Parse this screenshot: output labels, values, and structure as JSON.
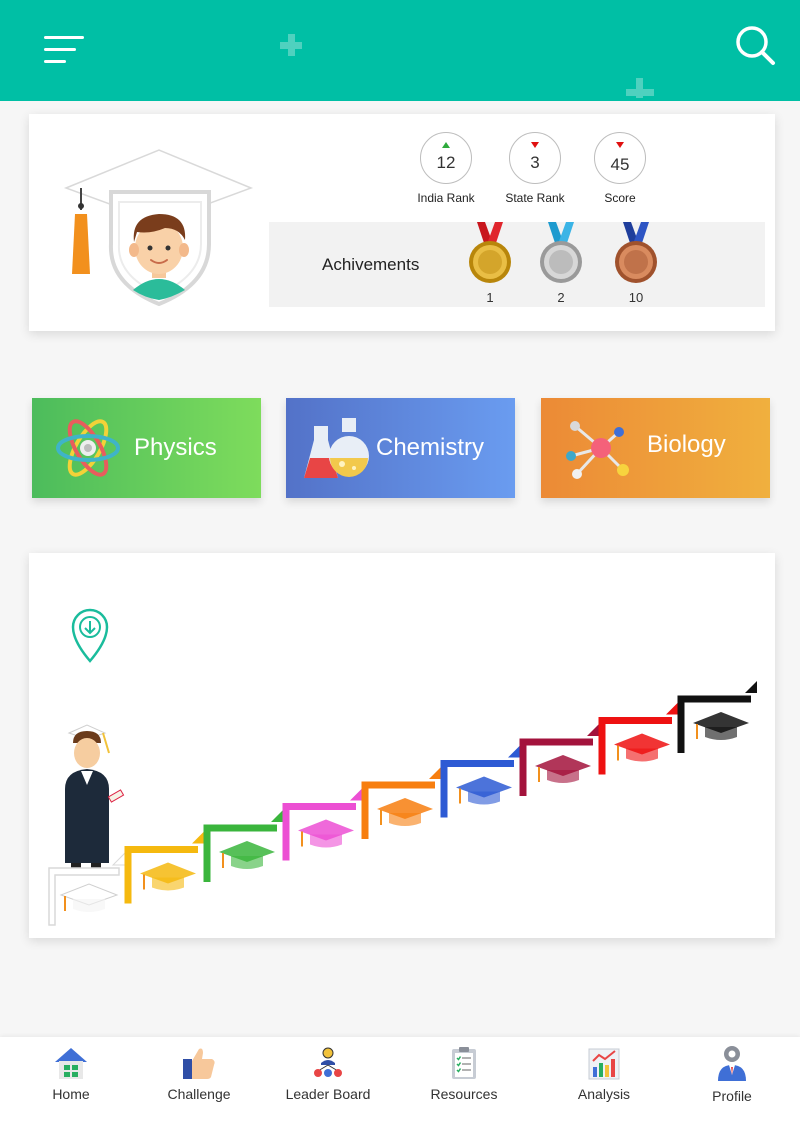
{
  "stats": [
    {
      "value": "12",
      "label": "India Rank",
      "trend": "up"
    },
    {
      "value": "3",
      "label": "State Rank",
      "trend": "down"
    },
    {
      "value": "45",
      "label": "Score",
      "trend": "down"
    }
  ],
  "achievements": {
    "label": "Achivements",
    "medals": [
      {
        "type": "gold",
        "count": "1"
      },
      {
        "type": "silver",
        "count": "2"
      },
      {
        "type": "bronze",
        "count": "10"
      }
    ]
  },
  "subjects": [
    {
      "label": "Physics",
      "icon": "atom-icon"
    },
    {
      "label": "Chemistry",
      "icon": "flask-icon"
    },
    {
      "label": "Biology",
      "icon": "molecule-icon"
    }
  ],
  "progress": {
    "step_colors": [
      "#ffffff",
      "#f5b90f",
      "#3ab53c",
      "#ec4fd3",
      "#f77e0f",
      "#2d5ad4",
      "#a3133c",
      "#ee1111",
      "#111111"
    ]
  },
  "nav": [
    {
      "label": "Home",
      "icon": "home-icon"
    },
    {
      "label": "Challenge",
      "icon": "thumbs-up-icon"
    },
    {
      "label": "Leader Board",
      "icon": "leaderboard-icon"
    },
    {
      "label": "Resources",
      "icon": "clipboard-icon"
    },
    {
      "label": "Analysis",
      "icon": "chart-icon"
    },
    {
      "label": "Profile",
      "icon": "profile-gear-icon"
    }
  ],
  "colors": {
    "header": "#00bfa5",
    "trend_up": "#2eaa3c",
    "trend_down": "#e01010"
  }
}
